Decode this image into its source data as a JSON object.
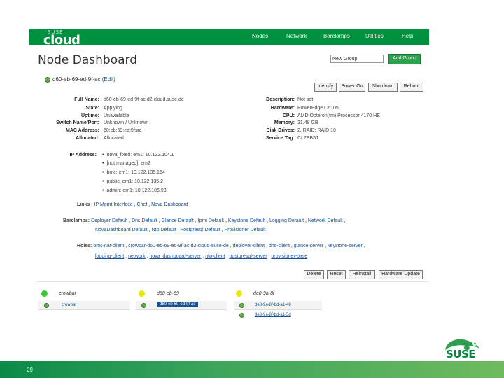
{
  "header": {
    "logo_small": "SUSE",
    "logo_big": "cloud",
    "nav": [
      "Nodes",
      "Network",
      "Barclamps",
      "Utilities",
      "Help"
    ]
  },
  "page": {
    "title": "Node Dashboard",
    "group_input": "New Group",
    "add_group_label": "Add Group"
  },
  "node": {
    "name": "d60-eb-69-ed-9f-ac",
    "edit_label": "(Edit)",
    "actions": [
      "Identify",
      "Power On",
      "Shutdown",
      "Reboot"
    ]
  },
  "details_left": [
    {
      "label": "Full Name:",
      "value": "d60-eb-69-ed-9f-ac.d2.cloud.suse.de"
    },
    {
      "label": "State:",
      "value": "Applying"
    },
    {
      "label": "Uptime:",
      "value": "Unavailable"
    },
    {
      "label": "Switch Name/Port:",
      "value": "Unknown / Unknown"
    },
    {
      "label": "MAC Address:",
      "value": "60:eb:69:ed:9f:ac"
    },
    {
      "label": "Allocated:",
      "value": "Allocated"
    }
  ],
  "details_right": [
    {
      "label": "Description:",
      "value": "Not set"
    },
    {
      "label": "Hardware:",
      "value": "PowerEdge C6105"
    },
    {
      "label": "CPU:",
      "value": "AMD Opteron(tm) Processor 4170 HE"
    },
    {
      "label": "Memory:",
      "value": "31.48 GB"
    },
    {
      "label": "Disk Drives:",
      "value": "2, RAID: RAID 10"
    },
    {
      "label": "Service Tag:",
      "value": "CL7BB5J"
    }
  ],
  "ip": {
    "label": "IP Address:",
    "items": [
      "nova_fixed: em1: 10.122.104.1",
      "[not managed]: em2",
      "bmc: em1: 10.122.135.164",
      "public: em1: 10.122.135.2",
      "admin: em1: 10.122.106.93"
    ]
  },
  "links": {
    "label": "Links :",
    "items": [
      "IP Mgmt Interface",
      "Chef",
      "Nova Dashboard"
    ]
  },
  "barclamps": {
    "label": "Barclamps:",
    "line1": [
      "Deployer Default",
      "Dns Default",
      "Glance Default",
      "Ipmi Default",
      "Keystone Default",
      "Logging Default",
      "Network Default"
    ],
    "line2": [
      "NovaDashboard Default",
      "Nto Default",
      "Postgresql Default",
      "Provisioner Default"
    ]
  },
  "roles": {
    "label": "Roles:",
    "line1": [
      "bmc-nat-client",
      "crowbar-d60-eb-69-ed-9f-ac-d2-cloud-suse-de",
      "deployer-client",
      "dns-client",
      "glance-server",
      "keystone-server"
    ],
    "line2": [
      "logging-client",
      "network",
      "nova_dashboard-server",
      "ntp-client",
      "postgresql-server",
      "provisioner-base"
    ]
  },
  "bottom_actions": [
    "Delete",
    "Reset",
    "Reinstall",
    "Hardware Update"
  ],
  "groups": [
    {
      "name": "crowbar",
      "items": [
        "crowbar"
      ],
      "color": "#33cc33"
    },
    {
      "name": "d60-eb-69",
      "items": [
        "d60-eb-69-ed-9f-ac"
      ],
      "color": "#e8e800"
    },
    {
      "name": "de8-9a-8f",
      "items": [
        "de8-9a-8f-bd-a1-48",
        "de8-9a-8f-bd-a1-5d"
      ],
      "color": "#e8e800"
    }
  ],
  "footer": {
    "page_number": "29",
    "brand": "SUSE"
  },
  "colors": {
    "brand_green": "#00913f",
    "link": "#1d4f91"
  }
}
